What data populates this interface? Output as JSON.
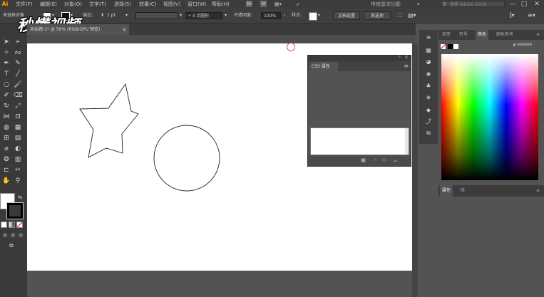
{
  "menubar": {
    "logo": "Ai",
    "items": [
      "文件(F)",
      "编辑(E)",
      "对象(O)",
      "文字(T)",
      "选择(S)",
      "效果(C)",
      "视图(V)",
      "窗口(W)",
      "帮助(H)"
    ],
    "bridge_icons": [
      "Br",
      "St"
    ],
    "workspace": "传统基本功能",
    "search_placeholder": "搜索 Adobe Stock",
    "window_controls": [
      "—",
      "□",
      "✕"
    ]
  },
  "controlbar": {
    "selection_label": "未选择对象",
    "stroke_label": "描边:",
    "stroke_value": "1 pt",
    "brush_value": "3 点圆形",
    "opacity_label": "不透明度:",
    "opacity_value": "100%",
    "style_label": "样式:",
    "doc_setup_button": "文档设置",
    "preferences_button": "首选项"
  },
  "document_tab": {
    "title": "未标题-1* @ 50% (RGB/GPU 预览)",
    "close": "×"
  },
  "watermark": "秒懂视频",
  "css_panel": {
    "title": "CSS 属性",
    "menu_icon": "≡"
  },
  "color_panel": {
    "tabs": [
      "渐变",
      "符号",
      "颜色",
      "颜色参考"
    ],
    "active_tab": "颜色",
    "hex_prefix": "#",
    "hex_value": "FFFFFF"
  },
  "attributes_panel": {
    "tabs": [
      "属性",
      "库"
    ],
    "active_tab": "属性"
  },
  "colors": {
    "accent": "#ff9a00",
    "fill": "#ffffff",
    "stroke": "#000000"
  }
}
